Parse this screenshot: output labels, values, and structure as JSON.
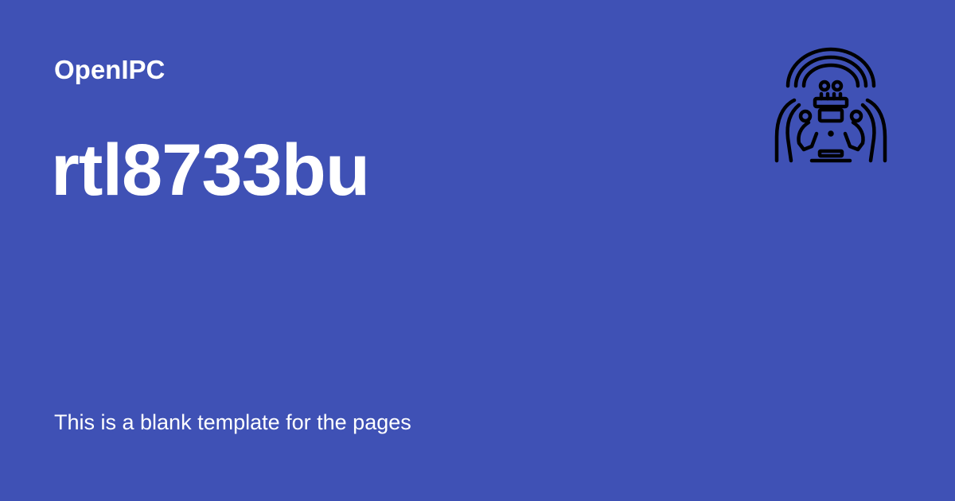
{
  "site": {
    "name": "OpenIPC"
  },
  "page": {
    "title": "rtl8733bu",
    "description": "This is a blank template for the pages"
  },
  "logo": {
    "icon": "openipc-logo-icon",
    "color": "#000000"
  },
  "colors": {
    "background": "#3f51b5",
    "text": "#ffffff"
  }
}
